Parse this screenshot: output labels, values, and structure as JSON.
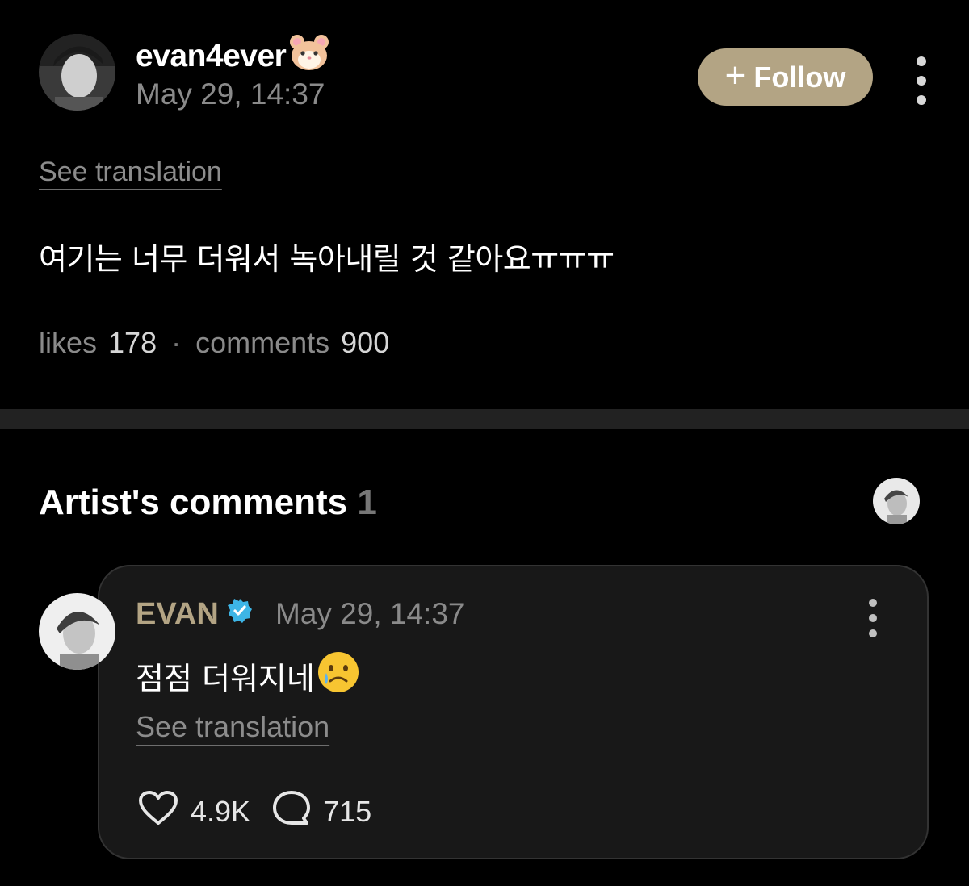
{
  "post": {
    "author": "evan4ever",
    "author_emoji": "hamster-face-icon",
    "date": "May 29, 14:37",
    "follow_plus": "+",
    "follow_label": "Follow",
    "see_translation": "See translation",
    "body": "여기는 너무 더워서 녹아내릴 것 같아요ㅠㅠㅠ",
    "likes_label": "likes",
    "likes_count": "178",
    "separator": "·",
    "comments_label": "comments",
    "comments_count": "900"
  },
  "artist_comments": {
    "title": "Artist's comments",
    "count": "1",
    "comment": {
      "author": "EVAN",
      "verified_icon": "verified-badge-icon",
      "date": "May 29, 14:37",
      "body": "점점 더워지네",
      "body_emoji": "face-holding-back-tears-icon",
      "see_translation": "See translation",
      "likes": "4.9K",
      "replies": "715"
    }
  },
  "colors": {
    "background": "#000000",
    "accent_gold": "#b3a484",
    "card_background": "#181818",
    "muted_text": "#8a8a8a",
    "verified_blue": "#3db5e6"
  }
}
